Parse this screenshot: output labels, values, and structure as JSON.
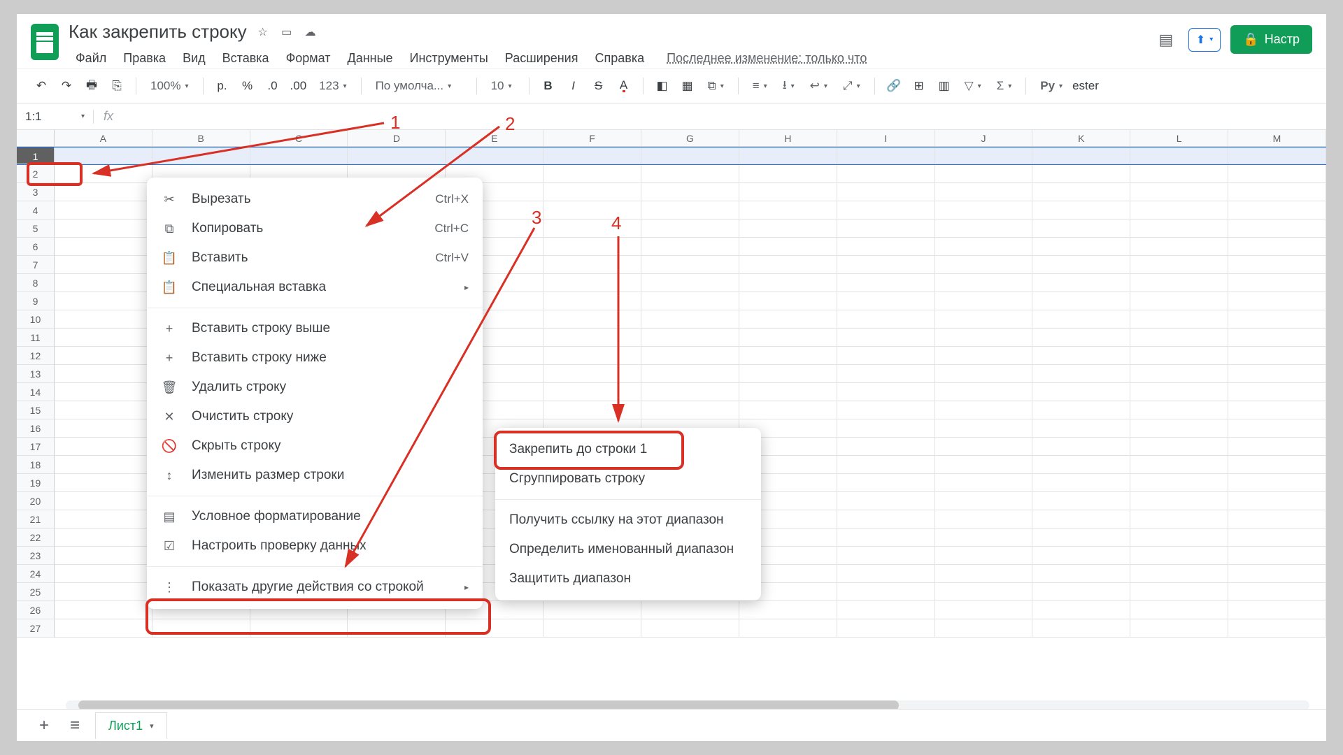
{
  "doc": {
    "title": "Как закрепить строку"
  },
  "menubar": [
    "Файл",
    "Правка",
    "Вид",
    "Вставка",
    "Формат",
    "Данные",
    "Инструменты",
    "Расширения",
    "Справка"
  ],
  "last_mod": "Последнее изменение: только что",
  "share": {
    "label": "Настр"
  },
  "toolbar": {
    "zoom": "100%",
    "currency": "р.",
    "percent": "%",
    "dec_dec": ".0",
    "dec_inc": ".00",
    "fmt": "123",
    "font": "По умолча...",
    "size": "10",
    "py": "Py"
  },
  "cellref": "1:1",
  "columns": [
    "A",
    "B",
    "C",
    "D",
    "E",
    "F",
    "G",
    "H",
    "I",
    "J",
    "K",
    "L",
    "M"
  ],
  "rows": 27,
  "ctx": {
    "cut": {
      "l": "Вырезать",
      "s": "Ctrl+X"
    },
    "copy": {
      "l": "Копировать",
      "s": "Ctrl+C"
    },
    "paste": {
      "l": "Вставить",
      "s": "Ctrl+V"
    },
    "pspecial": {
      "l": "Специальная вставка"
    },
    "insabove": {
      "l": "Вставить строку выше"
    },
    "insbelow": {
      "l": "Вставить строку ниже"
    },
    "delrow": {
      "l": "Удалить строку"
    },
    "clear": {
      "l": "Очистить строку"
    },
    "hide": {
      "l": "Скрыть строку"
    },
    "resize": {
      "l": "Изменить размер строки"
    },
    "condfmt": {
      "l": "Условное форматирование"
    },
    "datavalid": {
      "l": "Настроить проверку данных"
    },
    "more": {
      "l": "Показать другие действия со строкой"
    }
  },
  "sub": {
    "freeze": "Закрепить до строки 1",
    "group": "Сгруппировать строку",
    "link": "Получить ссылку на этот диапазон",
    "named": "Определить именованный диапазон",
    "protect": "Защитить диапазон"
  },
  "sheet": "Лист1",
  "ann": {
    "n1": "1",
    "n2": "2",
    "n3": "3",
    "n4": "4"
  }
}
